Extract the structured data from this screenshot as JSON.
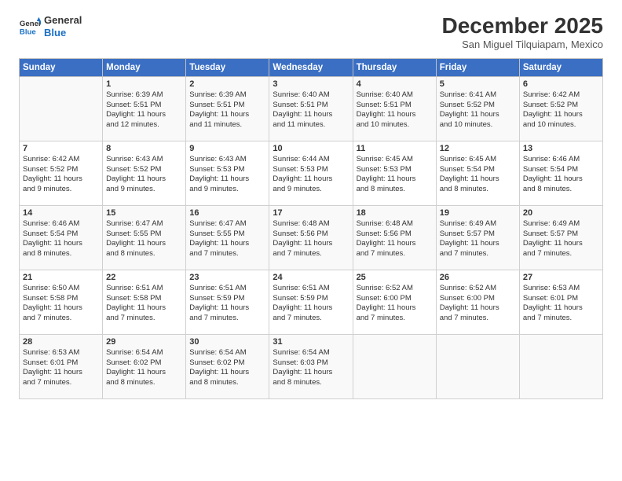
{
  "header": {
    "logo_line1": "General",
    "logo_line2": "Blue",
    "month": "December 2025",
    "location": "San Miguel Tilquiapam, Mexico"
  },
  "columns": [
    "Sunday",
    "Monday",
    "Tuesday",
    "Wednesday",
    "Thursday",
    "Friday",
    "Saturday"
  ],
  "weeks": [
    [
      {
        "num": "",
        "sunrise": "",
        "sunset": "",
        "daylight": ""
      },
      {
        "num": "1",
        "sunrise": "Sunrise: 6:39 AM",
        "sunset": "Sunset: 5:51 PM",
        "daylight": "Daylight: 11 hours and 12 minutes."
      },
      {
        "num": "2",
        "sunrise": "Sunrise: 6:39 AM",
        "sunset": "Sunset: 5:51 PM",
        "daylight": "Daylight: 11 hours and 11 minutes."
      },
      {
        "num": "3",
        "sunrise": "Sunrise: 6:40 AM",
        "sunset": "Sunset: 5:51 PM",
        "daylight": "Daylight: 11 hours and 11 minutes."
      },
      {
        "num": "4",
        "sunrise": "Sunrise: 6:40 AM",
        "sunset": "Sunset: 5:51 PM",
        "daylight": "Daylight: 11 hours and 10 minutes."
      },
      {
        "num": "5",
        "sunrise": "Sunrise: 6:41 AM",
        "sunset": "Sunset: 5:52 PM",
        "daylight": "Daylight: 11 hours and 10 minutes."
      },
      {
        "num": "6",
        "sunrise": "Sunrise: 6:42 AM",
        "sunset": "Sunset: 5:52 PM",
        "daylight": "Daylight: 11 hours and 10 minutes."
      }
    ],
    [
      {
        "num": "7",
        "sunrise": "Sunrise: 6:42 AM",
        "sunset": "Sunset: 5:52 PM",
        "daylight": "Daylight: 11 hours and 9 minutes."
      },
      {
        "num": "8",
        "sunrise": "Sunrise: 6:43 AM",
        "sunset": "Sunset: 5:52 PM",
        "daylight": "Daylight: 11 hours and 9 minutes."
      },
      {
        "num": "9",
        "sunrise": "Sunrise: 6:43 AM",
        "sunset": "Sunset: 5:53 PM",
        "daylight": "Daylight: 11 hours and 9 minutes."
      },
      {
        "num": "10",
        "sunrise": "Sunrise: 6:44 AM",
        "sunset": "Sunset: 5:53 PM",
        "daylight": "Daylight: 11 hours and 9 minutes."
      },
      {
        "num": "11",
        "sunrise": "Sunrise: 6:45 AM",
        "sunset": "Sunset: 5:53 PM",
        "daylight": "Daylight: 11 hours and 8 minutes."
      },
      {
        "num": "12",
        "sunrise": "Sunrise: 6:45 AM",
        "sunset": "Sunset: 5:54 PM",
        "daylight": "Daylight: 11 hours and 8 minutes."
      },
      {
        "num": "13",
        "sunrise": "Sunrise: 6:46 AM",
        "sunset": "Sunset: 5:54 PM",
        "daylight": "Daylight: 11 hours and 8 minutes."
      }
    ],
    [
      {
        "num": "14",
        "sunrise": "Sunrise: 6:46 AM",
        "sunset": "Sunset: 5:54 PM",
        "daylight": "Daylight: 11 hours and 8 minutes."
      },
      {
        "num": "15",
        "sunrise": "Sunrise: 6:47 AM",
        "sunset": "Sunset: 5:55 PM",
        "daylight": "Daylight: 11 hours and 8 minutes."
      },
      {
        "num": "16",
        "sunrise": "Sunrise: 6:47 AM",
        "sunset": "Sunset: 5:55 PM",
        "daylight": "Daylight: 11 hours and 7 minutes."
      },
      {
        "num": "17",
        "sunrise": "Sunrise: 6:48 AM",
        "sunset": "Sunset: 5:56 PM",
        "daylight": "Daylight: 11 hours and 7 minutes."
      },
      {
        "num": "18",
        "sunrise": "Sunrise: 6:48 AM",
        "sunset": "Sunset: 5:56 PM",
        "daylight": "Daylight: 11 hours and 7 minutes."
      },
      {
        "num": "19",
        "sunrise": "Sunrise: 6:49 AM",
        "sunset": "Sunset: 5:57 PM",
        "daylight": "Daylight: 11 hours and 7 minutes."
      },
      {
        "num": "20",
        "sunrise": "Sunrise: 6:49 AM",
        "sunset": "Sunset: 5:57 PM",
        "daylight": "Daylight: 11 hours and 7 minutes."
      }
    ],
    [
      {
        "num": "21",
        "sunrise": "Sunrise: 6:50 AM",
        "sunset": "Sunset: 5:58 PM",
        "daylight": "Daylight: 11 hours and 7 minutes."
      },
      {
        "num": "22",
        "sunrise": "Sunrise: 6:51 AM",
        "sunset": "Sunset: 5:58 PM",
        "daylight": "Daylight: 11 hours and 7 minutes."
      },
      {
        "num": "23",
        "sunrise": "Sunrise: 6:51 AM",
        "sunset": "Sunset: 5:59 PM",
        "daylight": "Daylight: 11 hours and 7 minutes."
      },
      {
        "num": "24",
        "sunrise": "Sunrise: 6:51 AM",
        "sunset": "Sunset: 5:59 PM",
        "daylight": "Daylight: 11 hours and 7 minutes."
      },
      {
        "num": "25",
        "sunrise": "Sunrise: 6:52 AM",
        "sunset": "Sunset: 6:00 PM",
        "daylight": "Daylight: 11 hours and 7 minutes."
      },
      {
        "num": "26",
        "sunrise": "Sunrise: 6:52 AM",
        "sunset": "Sunset: 6:00 PM",
        "daylight": "Daylight: 11 hours and 7 minutes."
      },
      {
        "num": "27",
        "sunrise": "Sunrise: 6:53 AM",
        "sunset": "Sunset: 6:01 PM",
        "daylight": "Daylight: 11 hours and 7 minutes."
      }
    ],
    [
      {
        "num": "28",
        "sunrise": "Sunrise: 6:53 AM",
        "sunset": "Sunset: 6:01 PM",
        "daylight": "Daylight: 11 hours and 7 minutes."
      },
      {
        "num": "29",
        "sunrise": "Sunrise: 6:54 AM",
        "sunset": "Sunset: 6:02 PM",
        "daylight": "Daylight: 11 hours and 8 minutes."
      },
      {
        "num": "30",
        "sunrise": "Sunrise: 6:54 AM",
        "sunset": "Sunset: 6:02 PM",
        "daylight": "Daylight: 11 hours and 8 minutes."
      },
      {
        "num": "31",
        "sunrise": "Sunrise: 6:54 AM",
        "sunset": "Sunset: 6:03 PM",
        "daylight": "Daylight: 11 hours and 8 minutes."
      },
      {
        "num": "",
        "sunrise": "",
        "sunset": "",
        "daylight": ""
      },
      {
        "num": "",
        "sunrise": "",
        "sunset": "",
        "daylight": ""
      },
      {
        "num": "",
        "sunrise": "",
        "sunset": "",
        "daylight": ""
      }
    ]
  ]
}
